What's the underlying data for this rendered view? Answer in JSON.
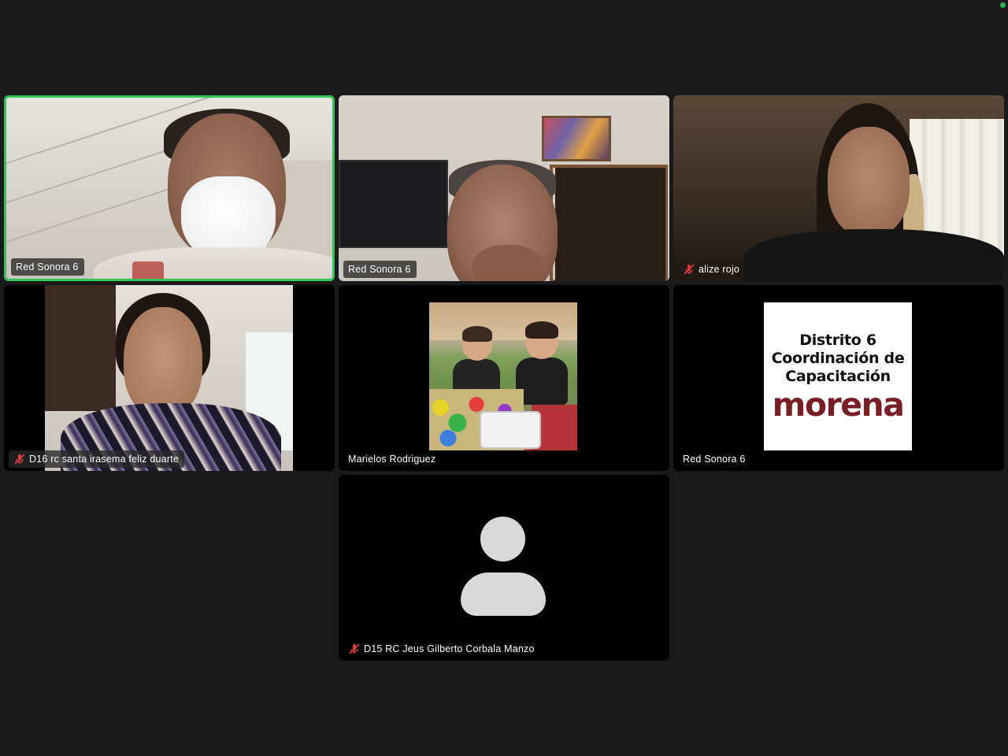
{
  "app": {
    "status_color": "#2cb24a",
    "active_speaker_color": "#2fc45a",
    "muted_icon_color": "#e5383b"
  },
  "participants": [
    {
      "name": "Red Sonora 6",
      "muted": false,
      "active_speaker": true,
      "video": "camera"
    },
    {
      "name": "Red Sonora 6",
      "muted": false,
      "active_speaker": false,
      "video": "camera"
    },
    {
      "name": "alize rojo",
      "muted": true,
      "active_speaker": false,
      "video": "camera"
    },
    {
      "name": "D16 rc santa irasema feliz duarte",
      "muted": true,
      "active_speaker": false,
      "video": "camera"
    },
    {
      "name": "Marielos Rodriguez",
      "muted": false,
      "active_speaker": false,
      "video": "profile-photo"
    },
    {
      "name": "Red Sonora 6",
      "muted": false,
      "active_speaker": false,
      "video": "profile-card"
    },
    {
      "name": "D15 RC Jeus Gilberto Corbala Manzo",
      "muted": true,
      "active_speaker": false,
      "video": "avatar-placeholder"
    }
  ],
  "profile_card": {
    "line1": "Distrito 6",
    "line2": "Coordinación de",
    "line3": "Capacitación",
    "brand": "morena",
    "brand_color": "#7b1e23"
  },
  "icons": {
    "muted": "mic-off-icon",
    "avatar": "user-placeholder-icon"
  }
}
